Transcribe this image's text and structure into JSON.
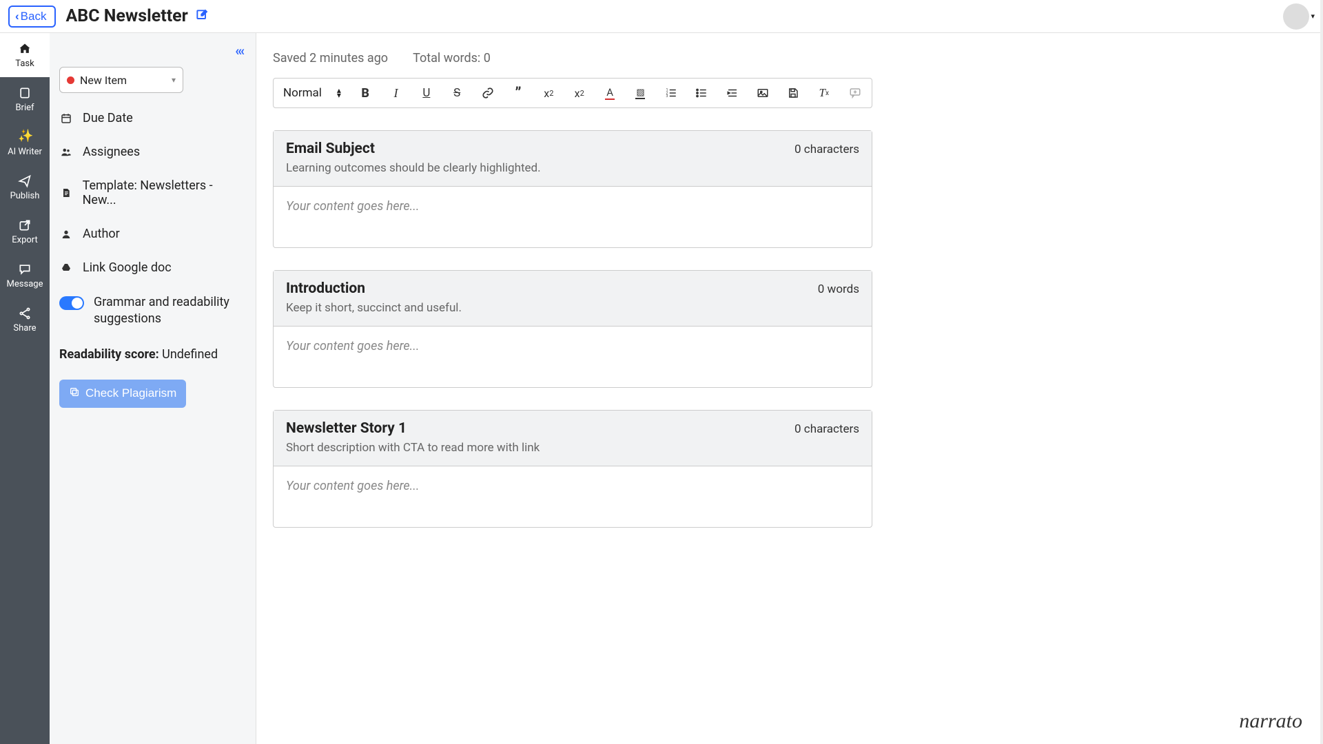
{
  "header": {
    "back_label": "Back",
    "title": "ABC Newsletter"
  },
  "rail": {
    "items": [
      {
        "label": "Task",
        "icon": "home-icon",
        "active": true
      },
      {
        "label": "Brief",
        "icon": "note-icon"
      },
      {
        "label": "AI Writer",
        "icon": "wand-icon"
      },
      {
        "label": "Publish",
        "icon": "send-icon"
      },
      {
        "label": "Export",
        "icon": "export-icon"
      },
      {
        "label": "Message",
        "icon": "chat-icon"
      },
      {
        "label": "Share",
        "icon": "share-icon"
      }
    ]
  },
  "panel": {
    "status_label": "New Item",
    "due_date": "Due Date",
    "assignees": "Assignees",
    "template": "Template: Newsletters - New...",
    "author": "Author",
    "link_gdoc": "Link Google doc",
    "grammar_toggle_label": "Grammar and readability suggestions",
    "grammar_toggle_on": true,
    "readability_label": "Readability score:",
    "readability_value": "Undefined",
    "plagiarism_btn": "Check Plagiarism"
  },
  "editor": {
    "saved_text": "Saved 2 minutes ago",
    "total_words_text": "Total words: 0",
    "format_style": "Normal",
    "placeholder": "Your content goes here...",
    "blocks": [
      {
        "title": "Email Subject",
        "count": "0 characters",
        "hint": "Learning outcomes should be clearly highlighted."
      },
      {
        "title": "Introduction",
        "count": "0 words",
        "hint": "Keep it short, succinct and useful."
      },
      {
        "title": "Newsletter Story 1",
        "count": "0 characters",
        "hint": "Short description with CTA to read more with link"
      }
    ]
  },
  "brand": "narrato"
}
